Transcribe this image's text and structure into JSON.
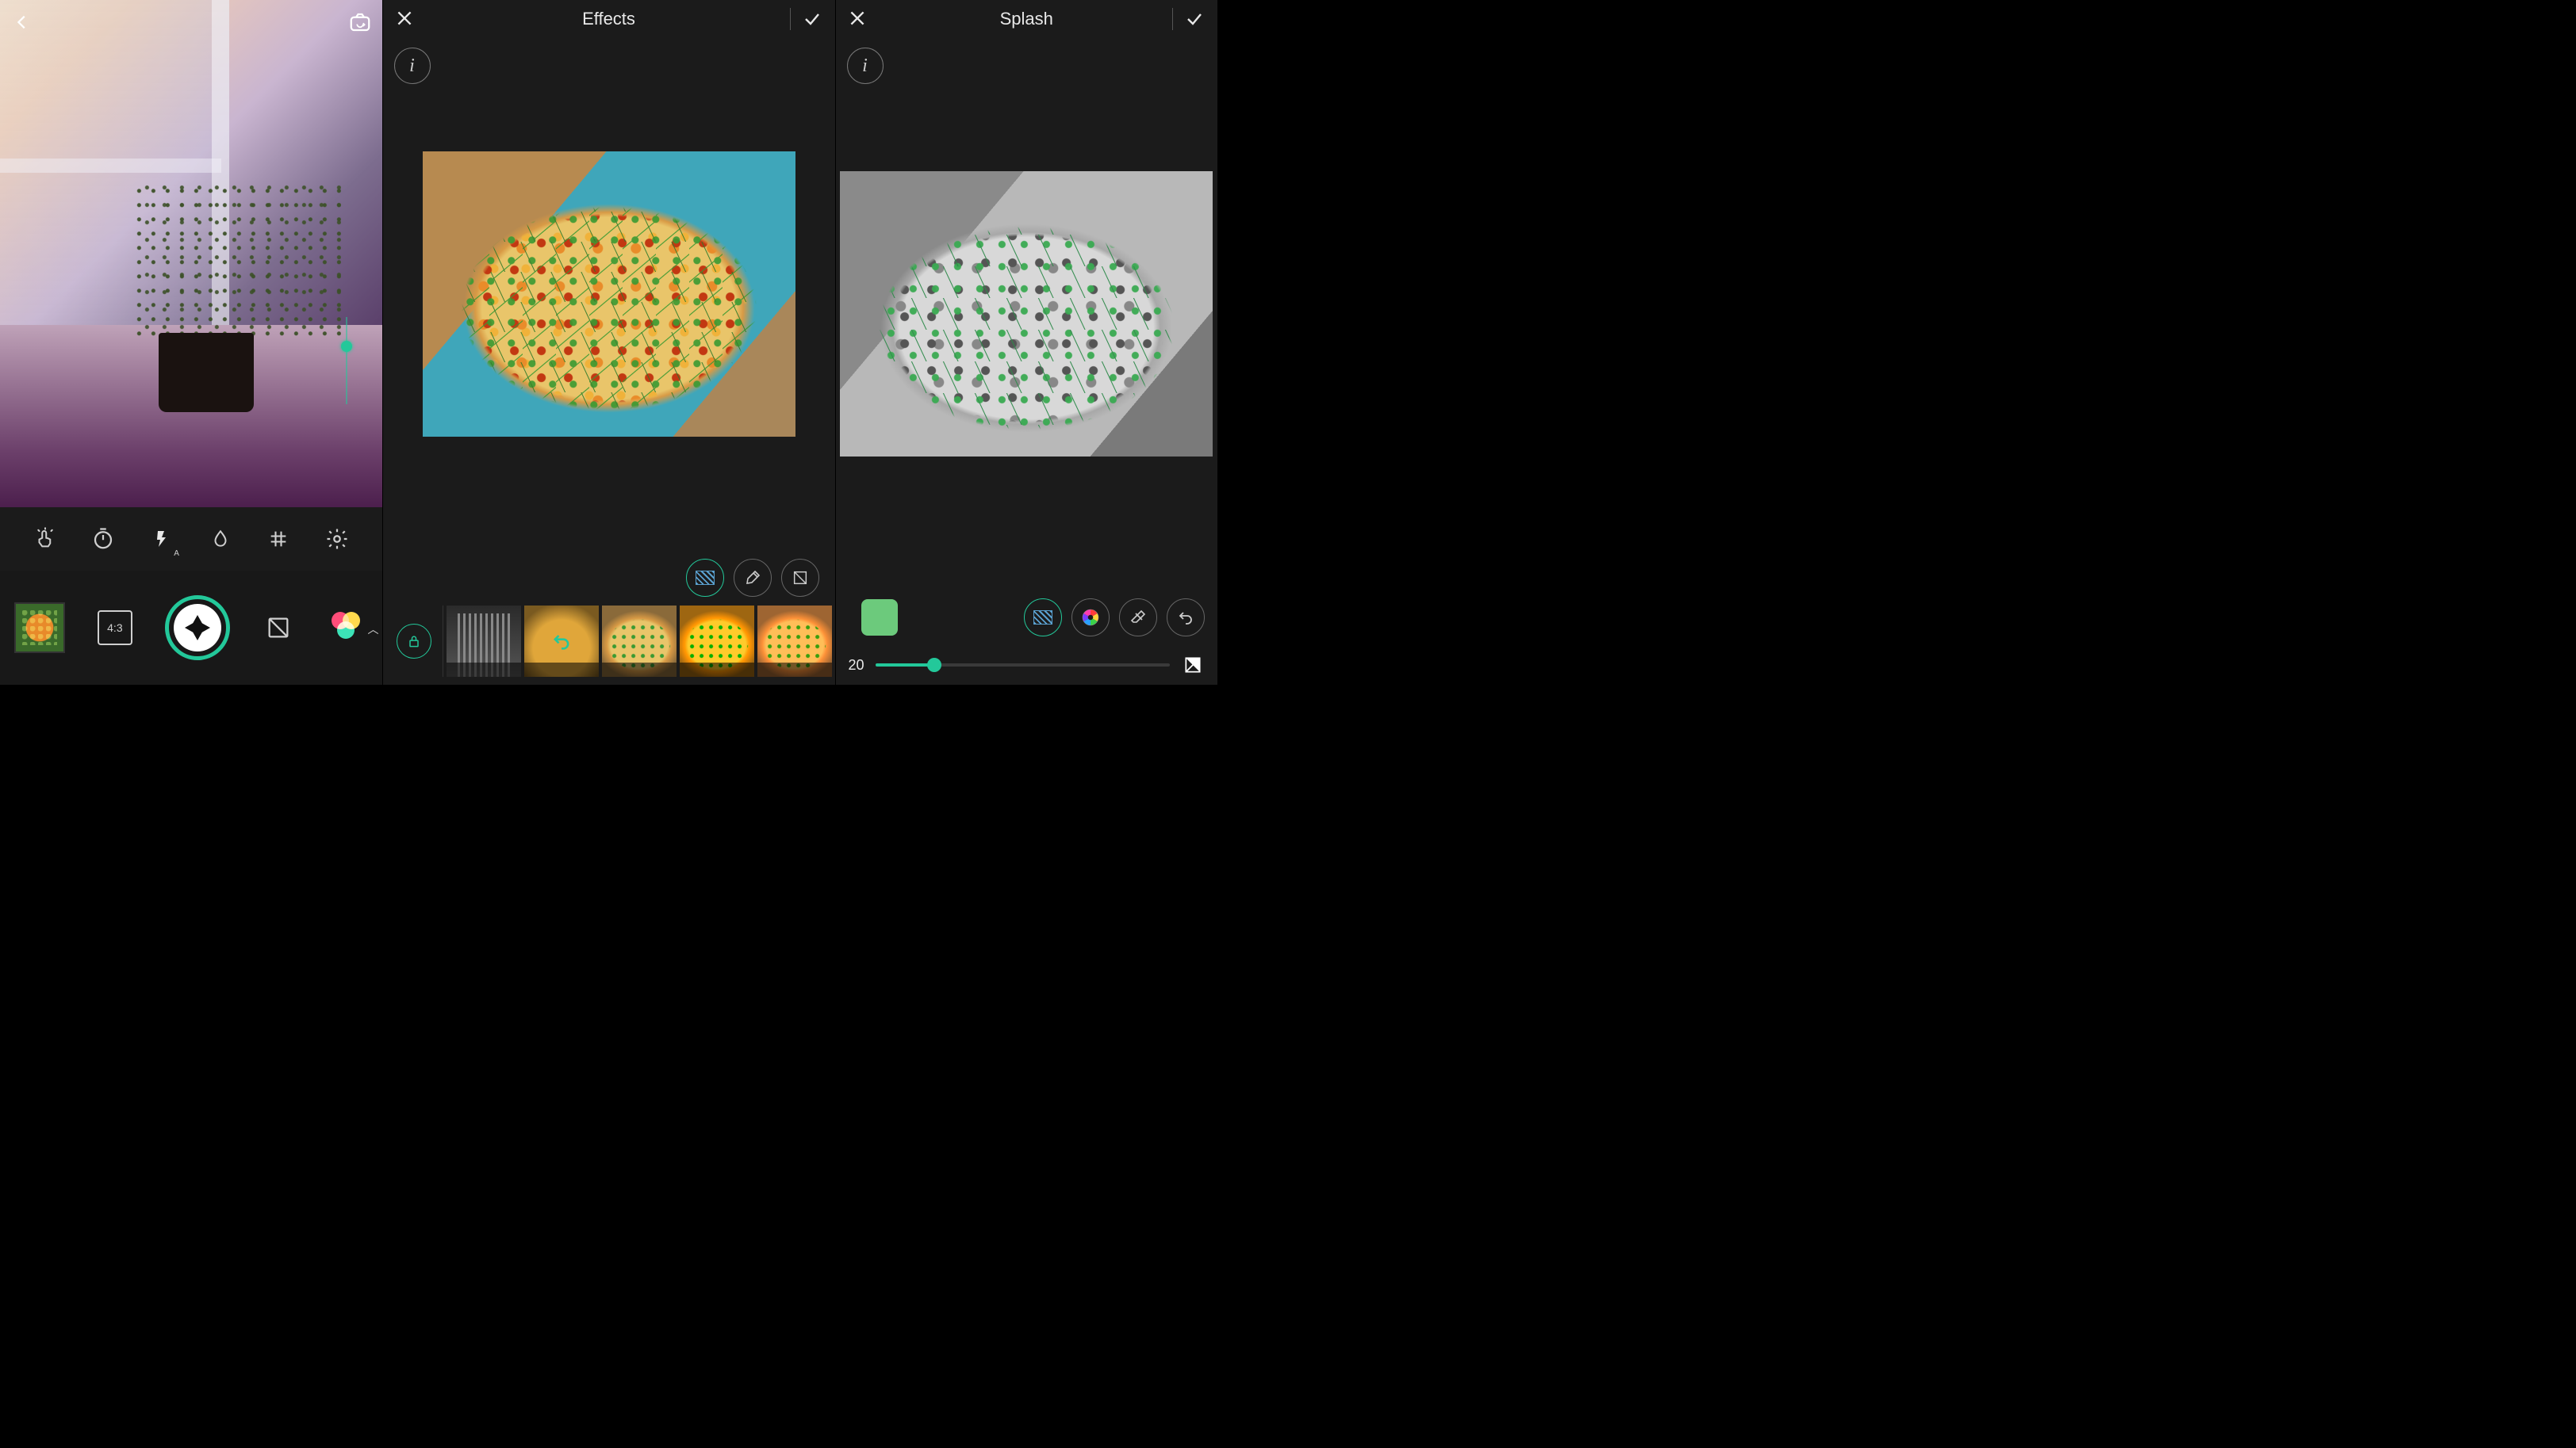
{
  "accent": "#23c89a",
  "camera": {
    "aspect_ratio": "4:3",
    "flash_mode_indicator": "A",
    "toolbar_icons": [
      "touch",
      "timer",
      "flash",
      "blur",
      "grid",
      "settings"
    ],
    "bottom_items": [
      "gallery",
      "aspect_ratio",
      "shutter",
      "mask",
      "color_filters"
    ]
  },
  "effects": {
    "title": "Effects",
    "mode_buttons": [
      "apply-area",
      "brush",
      "mask"
    ],
    "active_mode": "apply-area",
    "thumbs": [
      {
        "id": "city",
        "label": ""
      },
      {
        "id": "original",
        "label": "",
        "has_undo": true
      },
      {
        "id": "preset1",
        "label": ""
      },
      {
        "id": "preset2",
        "label": ""
      },
      {
        "id": "preset3",
        "label": ""
      }
    ]
  },
  "splash": {
    "title": "Splash",
    "swatch_color": "#6cca7c",
    "tool_buttons": [
      "apply-area",
      "color-wheel",
      "eraser",
      "undo"
    ],
    "active_tool": "apply-area",
    "slider_value": "20",
    "slider_percent": 20
  }
}
